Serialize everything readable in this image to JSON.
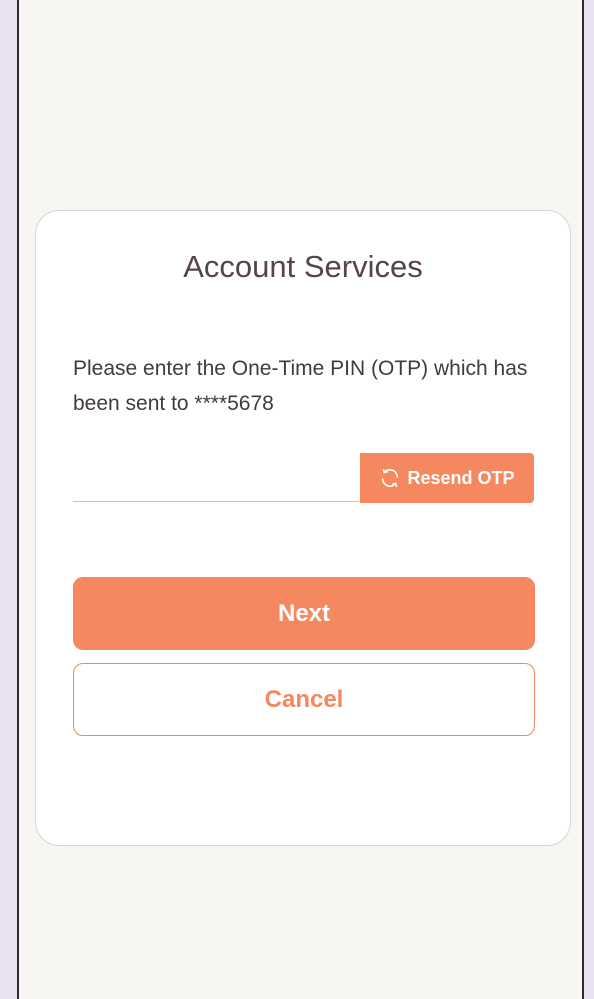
{
  "dialog": {
    "title": "Account Services",
    "message": "Please enter the One-Time PIN (OTP) which has been sent to ****5678",
    "otp_field": {
      "value": "",
      "placeholder": ""
    },
    "resend": {
      "label": "Resend OTP",
      "icon": "refresh-icon"
    },
    "next_label": "Next",
    "cancel_label": "Cancel"
  },
  "colors": {
    "accent": "#f5885e",
    "title_text": "#56444a",
    "body_text": "#433a3c",
    "screen_background": "#f8f6f2",
    "card_background": "#ffffff",
    "outer_background": "#e8e2f0"
  }
}
